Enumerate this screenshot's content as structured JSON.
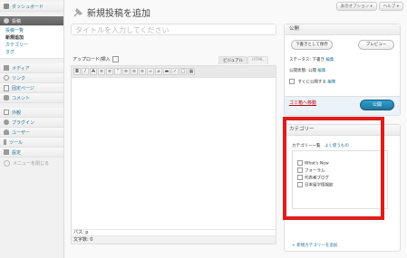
{
  "header": {
    "screen_options": "表示オプション",
    "help": "ヘルプ"
  },
  "sidebar": {
    "dashboard": "ダッシュボード",
    "posts": "投稿",
    "posts_sub": [
      "投稿一覧",
      "新規追加",
      "カテゴリー",
      "タグ"
    ],
    "group2": [
      "メディア",
      "リンク",
      "固定ページ",
      "コメント"
    ],
    "group3": [
      "外観",
      "プラグイン",
      "ユーザー",
      "ツール",
      "設定"
    ],
    "collapse": "メニューを閉じる"
  },
  "page": {
    "title": "新規投稿を追加",
    "title_placeholder": "タイトルを入力してください"
  },
  "editor": {
    "upload_label": "アップロード/挿入",
    "tab_visual": "ビジュアル",
    "tab_html": "HTML",
    "path": "パス: p",
    "word_count": "文字数: 0"
  },
  "publish": {
    "title": "公開",
    "save_draft": "下書きとして保存",
    "preview": "プレビュー",
    "status_label": "ステータス: 下書き",
    "status_edit": "編集",
    "visibility_label": "公開状態: 公開",
    "visibility_edit": "編集",
    "schedule_label": "すぐに公開する",
    "schedule_edit": "編集",
    "trash": "ゴミ箱へ移動",
    "publish_btn": "公開"
  },
  "categories": {
    "title": "カテゴリー",
    "tab_all": "カテゴリー一覧",
    "tab_popular": "よく使うもの",
    "items": [
      "What's New",
      "フォーラム",
      "代表者ブログ",
      "日本留学情報館"
    ],
    "add_new": "+ 新規カテゴリーを追加"
  },
  "colors": {
    "highlight": "#e21b1b",
    "link": "#21759b",
    "active_menu": "#6d6d6d"
  }
}
